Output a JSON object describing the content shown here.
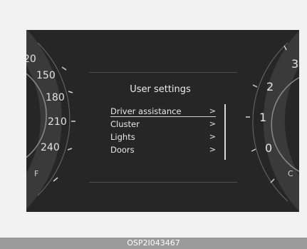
{
  "speed_gauge": {
    "ticks": [
      "20",
      "150",
      "180",
      "210",
      "240"
    ],
    "fuel_letter": "F"
  },
  "rpm_gauge": {
    "ticks": [
      "3",
      "2",
      "1",
      "0"
    ],
    "temp_letter": "C"
  },
  "menu": {
    "title": "User settings",
    "items": [
      {
        "label": "Driver assistance",
        "chevron": ">"
      },
      {
        "label": "Cluster",
        "chevron": ">"
      },
      {
        "label": "Lights",
        "chevron": ">"
      },
      {
        "label": "Doors",
        "chevron": ">"
      }
    ],
    "selected_index": 0
  },
  "footer": {
    "code": "OSP2I043467"
  }
}
